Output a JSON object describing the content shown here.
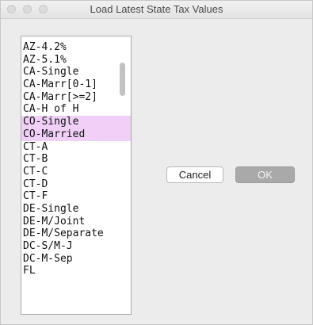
{
  "window": {
    "title": "Load Latest State Tax Values"
  },
  "list": {
    "items": [
      {
        "label": "AZ-4.2%",
        "selected": false
      },
      {
        "label": "AZ-5.1%",
        "selected": false
      },
      {
        "label": "CA-Single",
        "selected": false
      },
      {
        "label": "CA-Marr[0-1]",
        "selected": false
      },
      {
        "label": "CA-Marr[>=2]",
        "selected": false
      },
      {
        "label": "CA-H of H",
        "selected": false
      },
      {
        "label": "CO-Single",
        "selected": true
      },
      {
        "label": "CO-Married",
        "selected": true
      },
      {
        "label": "CT-A",
        "selected": false
      },
      {
        "label": "CT-B",
        "selected": false
      },
      {
        "label": "CT-C",
        "selected": false
      },
      {
        "label": "CT-D",
        "selected": false
      },
      {
        "label": "CT-F",
        "selected": false
      },
      {
        "label": "DE-Single",
        "selected": false
      },
      {
        "label": "DE-M/Joint",
        "selected": false
      },
      {
        "label": "DE-M/Separate",
        "selected": false
      },
      {
        "label": "DC-S/M-J",
        "selected": false
      },
      {
        "label": "DC-M-Sep",
        "selected": false
      },
      {
        "label": "FL",
        "selected": false
      }
    ],
    "selection_color": "#f0d0f7"
  },
  "buttons": {
    "cancel_label": "Cancel",
    "ok_label": "OK"
  }
}
